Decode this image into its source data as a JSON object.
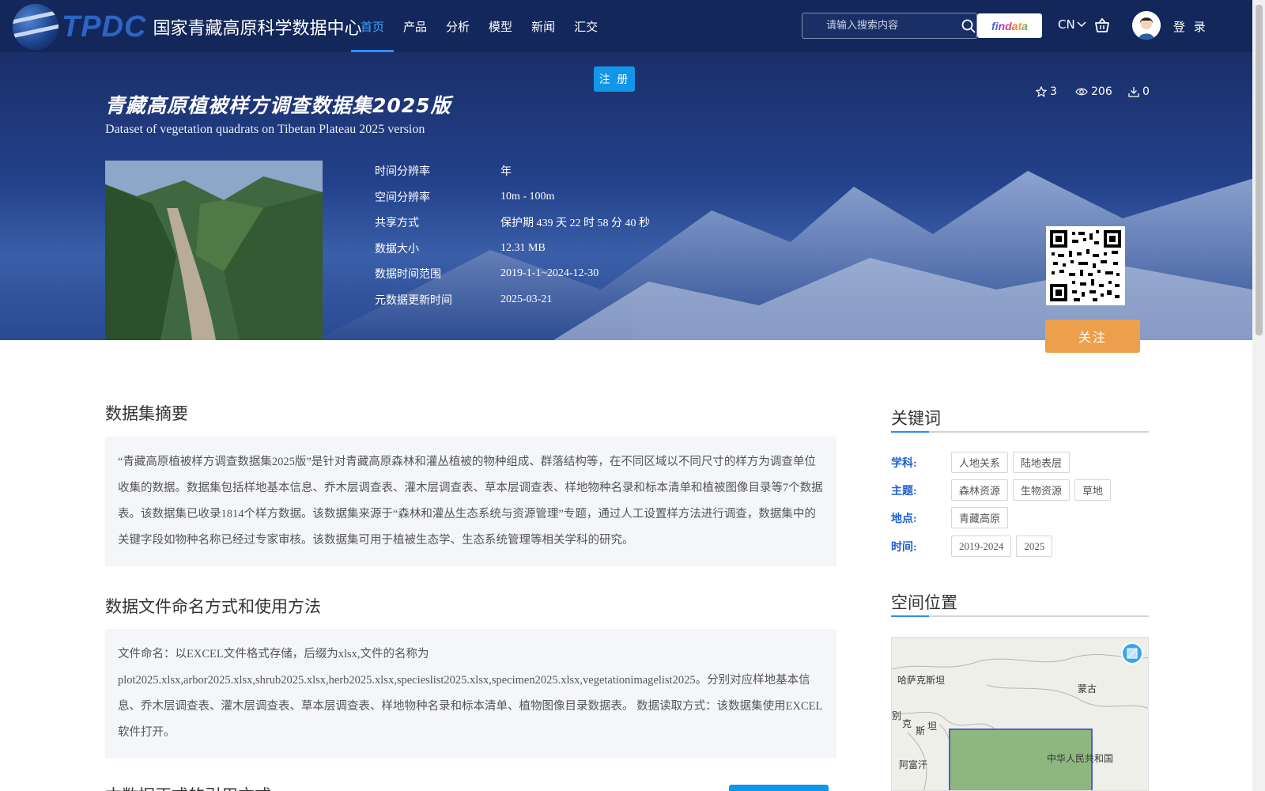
{
  "header": {
    "logo_text": "TPDC",
    "logo_name": "国家青藏高原科学数据中心",
    "nav": [
      {
        "label": "首页",
        "active": true
      },
      {
        "label": "产品",
        "active": false
      },
      {
        "label": "分析",
        "active": false
      },
      {
        "label": "模型",
        "active": false
      },
      {
        "label": "新闻",
        "active": false
      },
      {
        "label": "汇交",
        "active": false
      }
    ],
    "search_placeholder": "请输入搜索内容",
    "findata_label": "findata",
    "lang_label": "CN",
    "login_label": "登 录"
  },
  "hero": {
    "register_label": "注 册",
    "title_cn": "青藏高原植被样方调查数据集2025版",
    "title_en": "Dataset of vegetation quadrats on Tibetan Plateau 2025 version",
    "stats": {
      "favorites": "3",
      "views": "206",
      "downloads": "0"
    },
    "meta": [
      {
        "label": "时间分辨率",
        "value": "年"
      },
      {
        "label": "空间分辨率",
        "value": "10m - 100m"
      },
      {
        "label": "共享方式",
        "value": "保护期 439 天 22 时 58 分 40 秒"
      },
      {
        "label": "数据大小",
        "value": "12.31 MB"
      },
      {
        "label": "数据时间范围",
        "value": "2019-1-1~2024-12-30"
      },
      {
        "label": "元数据更新时间",
        "value": "2025-03-21"
      }
    ],
    "follow_label": "关注"
  },
  "main": {
    "summary_title": "数据集摘要",
    "summary_text": "“青藏高原植被样方调查数据集2025版”是针对青藏高原森林和灌丛植被的物种组成、群落结构等，在不同区域以不同尺寸的样方为调查单位收集的数据。数据集包括样地基本信息、乔木层调查表、灌木层调查表、草本层调查表、样地物种名录和标本清单和植被图像目录等7个数据表。该数据集已收录1814个样方数据。该数据集来源于“森林和灌丛生态系统与资源管理”专题，通过人工设置样方法进行调查，数据集中的关键字段如物种名称已经过专家审核。该数据集可用于植被生态学、生态系统管理等相关学科的研究。",
    "naming_title": "数据文件命名方式和使用方法",
    "naming_text": "文件命名：以EXCEL文件格式存储，后缀为xlsx,文件的名称为plot2025.xlsx,arbor2025.xlsx,shrub2025.xlsx,herb2025.xlsx,specieslist2025.xlsx,specimen2025.xlsx,vegetationimagelist2025。分别对应样地基本信息、乔木层调查表、灌木层调查表、草本层调查表、样地物种名录和标本清单、植物图像目录数据表。 数据读取方式：该数据集使用EXCEL软件打开。",
    "next_title": "本数据正式的引用方式"
  },
  "sidebar": {
    "keywords_title": "关键词",
    "keyword_groups": [
      {
        "label": "学科:",
        "tags": [
          "人地关系",
          "陆地表层"
        ]
      },
      {
        "label": "主题:",
        "tags": [
          "森林资源",
          "生物资源",
          "草地"
        ]
      },
      {
        "label": "地点:",
        "tags": [
          "青藏高原"
        ]
      },
      {
        "label": "时间:",
        "tags": [
          "2019-2024",
          "2025"
        ]
      }
    ],
    "location_title": "空间位置",
    "map_labels": [
      "哈萨克斯坦",
      "蒙古",
      "克",
      "斯",
      "坦",
      "阿富汗",
      "中华人民共和国",
      "别"
    ]
  }
}
